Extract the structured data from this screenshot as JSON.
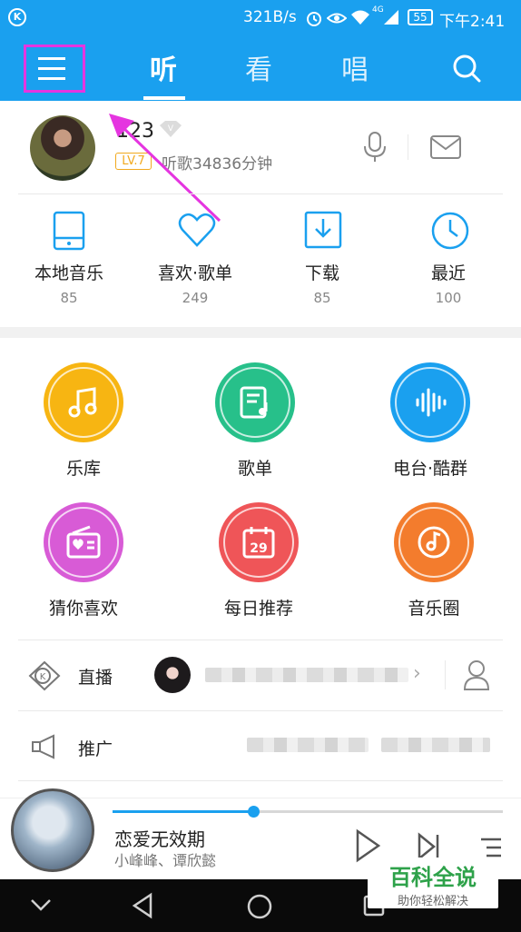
{
  "status_bar": {
    "speed": "321B/s",
    "battery": "55",
    "time": "下午2:41"
  },
  "header": {
    "tabs": [
      {
        "label": "听"
      },
      {
        "label": "看"
      },
      {
        "label": "唱"
      }
    ]
  },
  "profile": {
    "username": "123",
    "level": "LV.7",
    "listen_time": "听歌34836分钟"
  },
  "quick_items": [
    {
      "label": "本地音乐",
      "count": "85"
    },
    {
      "label": "喜欢·歌单",
      "count": "249"
    },
    {
      "label": "下载",
      "count": "85"
    },
    {
      "label": "最近",
      "count": "100"
    }
  ],
  "grid_items": [
    {
      "label": "乐库",
      "color": "#f7b512"
    },
    {
      "label": "歌单",
      "color": "#27c08a"
    },
    {
      "label": "电台·酷群",
      "color": "#1aa0ef"
    },
    {
      "label": "猜你喜欢",
      "color": "#d85bd6"
    },
    {
      "label": "每日推荐",
      "color": "#ef5558",
      "day": "29"
    },
    {
      "label": "音乐圈",
      "color": "#f37c2d"
    }
  ],
  "rows": {
    "live_label": "直播",
    "promo_label": "推广"
  },
  "player": {
    "title": "恋爱无效期",
    "artist": "小峰峰、谭欣懿",
    "progress": 0.36
  },
  "watermark": {
    "title": "百科全说",
    "subtitle": "助你轻松解决"
  }
}
